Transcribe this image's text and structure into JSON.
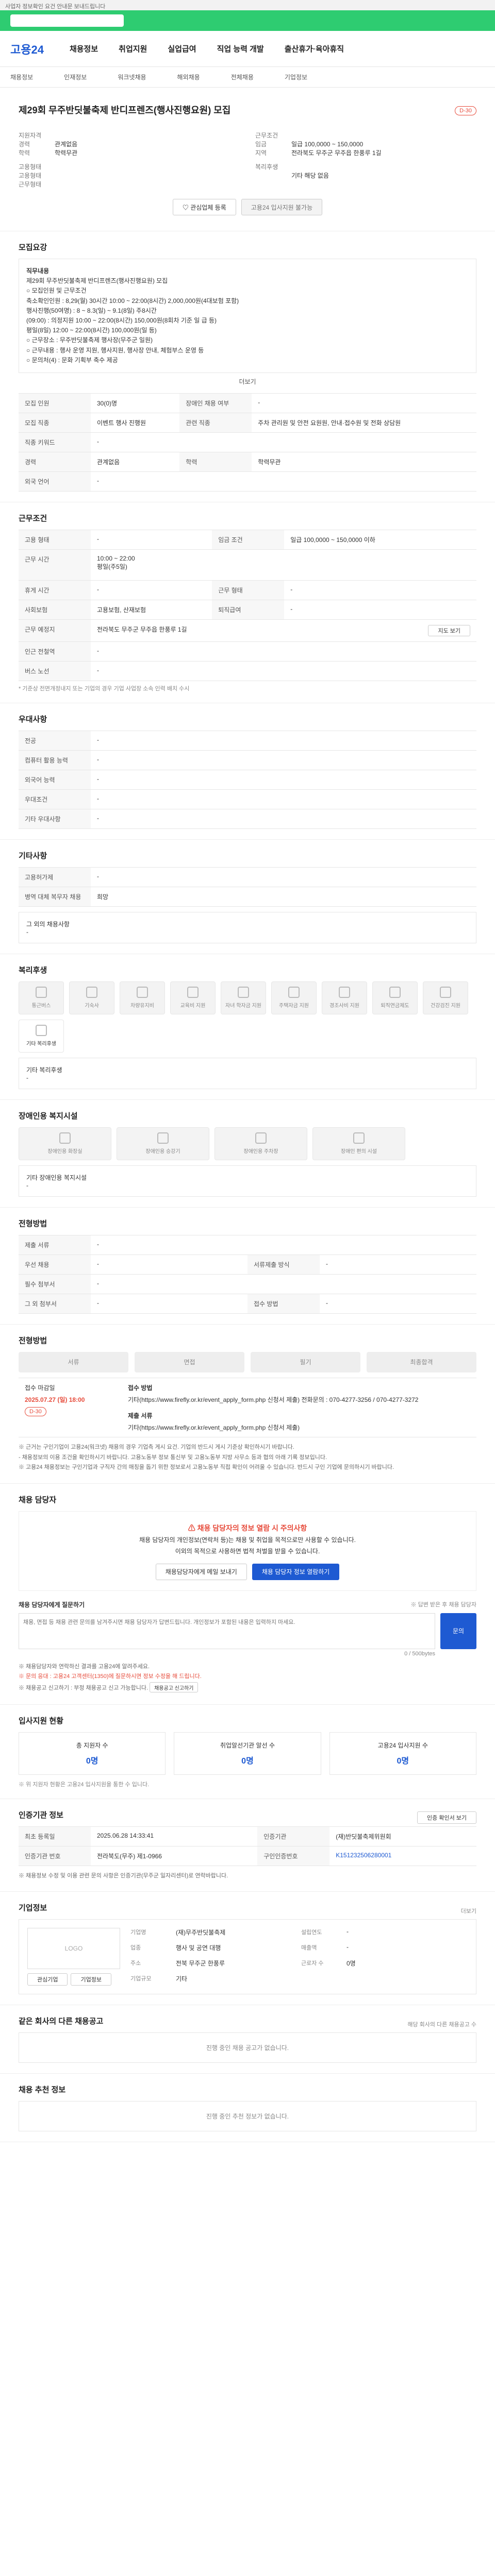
{
  "top": {
    "notice": "사업자 정보확인 요건 안내문 보내드립니다"
  },
  "nav": {
    "logo": "고용24",
    "items": [
      "채용정보",
      "취업지원",
      "실업급여",
      "직업 능력 개발",
      "출산휴가·육아휴직"
    ]
  },
  "subnav": [
    "채용정보",
    "인재정보",
    "워크넷채용",
    "해외채용",
    "전체채용",
    "기업정보"
  ],
  "job": {
    "title": "제29회 무주반딧불축제 반디프렌즈(행사진행요원) 모집",
    "dday": "D-30",
    "summary": [
      {
        "k": "지원자격",
        "v": ""
      },
      {
        "k": "경력",
        "v": "관계없음"
      },
      {
        "k": "학력",
        "v": "학력무관"
      },
      {
        "k": "고용형태",
        "v": ""
      },
      {
        "k": "고용형태",
        "v": ""
      },
      {
        "k": "근무형태",
        "v": ""
      }
    ],
    "conditions": [
      {
        "k": "근무조건",
        "v": ""
      },
      {
        "k": "임금",
        "v": "일급 100,0000 ~ 150,0000"
      },
      {
        "k": "지역",
        "v": "전라북도 무주군 무주읍 한풍루 1길"
      },
      {
        "k": "복리후생",
        "v": ""
      },
      {
        "k": "",
        "v": "기타 해당 없음"
      }
    ],
    "btn_scrap": "관심업체 등록",
    "btn_apply": "고용24 입사지원 불가능"
  },
  "recruit": {
    "heading": "모집요강",
    "content_label": "직무내용",
    "content": "제29회 무주반딧불축제 반디프렌즈(행사진행요원) 모집\n○ 모집인원 및 근무조건\n축소확인인원 : 8,29(월) 30시간 10:00 ~ 22:00(8시간) 2,000,000원(4대보험 포함)\n행사진행(50여명) : 8 ~ 8.3(일) ~ 9.1(8일) 주8시간\n(09:00) : 의정지원 10:00 ~ 22:00(8시간) 150,000원(8회차 기준 일 급 등)\n평일(8일) 12:00 ~ 22:00(8시간) 100,000원(일 등)\n○ 근무장소 : 무주반딧불축제 행사장(무주군 일원)\n○ 근무내용 : 행사 운영 지원, 행사지원, 행사장 안내, 체험부스 운영 등\n○ 문의처(4) : 문화 기획부 축수 제공",
    "more": "더보기",
    "rows": [
      {
        "k": "모집 인원",
        "v": "30(0)명",
        "k2": "장애인 채용 여부",
        "v2": "-"
      },
      {
        "k": "모집 직종",
        "v": "이벤트 행사 진행원",
        "k2": "관련 직종",
        "v2": "주차 관리원 및 안전 요원원, 안내·접수원 및 전화 상담원"
      },
      {
        "k": "직종 키워드",
        "v": "-",
        "k2": "",
        "v2": ""
      },
      {
        "k": "경력",
        "v": "관계없음",
        "k2": "학력",
        "v2": "학력무관"
      },
      {
        "k": "외국 언어",
        "v": "-",
        "k2": "",
        "v2": ""
      }
    ]
  },
  "work": {
    "heading": "근무조건",
    "rows": [
      {
        "k": "고용 형태",
        "v": "-",
        "k2": "임금 조건",
        "v2": "일급 100,0000 ~ 150,0000 이하"
      },
      {
        "k": "근무 시간",
        "v": "10:00 ~ 22:00\n평일(주5일)",
        "k2": "",
        "v2": ""
      },
      {
        "k": "휴게 시간",
        "v": "-",
        "k2": "근무 형태",
        "v2": "-"
      },
      {
        "k": "사회보험",
        "v": "고용보험, 산재보험",
        "k2": "퇴직급여",
        "v2": "-"
      },
      {
        "k": "근무 예정지",
        "v": "전라북도 무주군 무주읍 한풍루 1길",
        "k2": "",
        "v2": ""
      },
      {
        "k": "인근 전철역",
        "v": "-",
        "k2": "",
        "v2": ""
      },
      {
        "k": "버스 노선",
        "v": "-",
        "k2": "",
        "v2": ""
      }
    ],
    "map_btn": "지도 보기",
    "note": "* 기준상 전면개정내지 또는 기업의 경우 기업 사업장 소속 인력 배치 수시"
  },
  "pref": {
    "heading": "우대사항",
    "rows": [
      {
        "k": "전공",
        "v": "-"
      },
      {
        "k": "컴퓨터 활용 능력",
        "v": "-"
      },
      {
        "k": "외국어 능력",
        "v": "-"
      },
      {
        "k": "우대조건",
        "v": "-"
      },
      {
        "k": "기타 우대사항",
        "v": "-"
      }
    ]
  },
  "etc": {
    "heading": "기타사항",
    "rows": [
      {
        "k": "고용허가제",
        "v": "-"
      },
      {
        "k": "병역 대체 복무자 채용",
        "v": "희망"
      },
      {
        "k": "",
        "v": ""
      }
    ],
    "other_label": "그 외의 채용사항",
    "other_value": "-"
  },
  "welfare": {
    "heading": "복리후생",
    "items": [
      "통근버스",
      "기숙사",
      "차량유지비",
      "교육비 지원",
      "자녀 학자금 지원",
      "주택자금 지원",
      "경조사비 지원",
      "퇴직연금제도",
      "건강검진 지원",
      "기타 복리후생"
    ],
    "other_label": "기타 복리후생",
    "other_value": "-"
  },
  "disability": {
    "heading": "장애인용 복지시설",
    "items": [
      "장애인용 화장실",
      "장애인용 승강기",
      "장애인용 주차장",
      "장애인 편의 시설"
    ],
    "other_label": "기타 장애인용 복지시설",
    "other_value": "-"
  },
  "selection": {
    "heading": "전형방법",
    "rows": [
      {
        "k": "제출 서류",
        "v": "-",
        "k2": "",
        "v2": ""
      },
      {
        "k": "우선 채용",
        "v": "-",
        "k2": "서류제출 방식",
        "v2": "-"
      },
      {
        "k": "필수 첨부서",
        "v": "-",
        "k2": "",
        "v2": ""
      },
      {
        "k": "그 외 첨부서",
        "v": "-",
        "k2": "접수 방법",
        "v2": "-"
      }
    ]
  },
  "process": {
    "heading": "전형방법",
    "steps": [
      "서류",
      "면접",
      "필기",
      "최종합격"
    ],
    "deadline_label": "접수 마감일",
    "deadline": "2025.07.27 (일) 18:00",
    "deadline_dday": "D-30",
    "method_label": "접수 방법",
    "method": "기타(https://www.firefly.or.kr/event_apply_form.php 신청서 제출) 전화문의 : 070-4277-3256 / 070-4277-3272",
    "doc_label": "제출 서류",
    "doc": "기타(https://www.firefly.or.kr/event_apply_form.php 신청서 제출)",
    "notes": [
      "※ 근거는 구인기업이 고용24(워크넷) 채용의 경우 기업측 게시 요건. 기업의 반드시 게시 기준상 확인하시기 바랍니다.",
      "- 채용정보의 이용 조건을 확인하시기 바랍니다. 고용노동부 정보 통신부 및 고용노동부 지방 사무소 등과 협의 아래 기록 정보입니다.",
      "※ 고용24 채용정보는 구인기업과 구직자 간의 매칭을 돕기 위한 정보로서 고용노동부 직접 확인이 어려울 수 있습니다. 반드시 구인 기업에 문의하시기 바랍니다."
    ]
  },
  "contact": {
    "heading": "채용 담당자",
    "warn_title": "채용 담당자의 정보 열람 시 주의사항",
    "warn_body": "채용 담당자의 개인정보(연락처 등)는 채용 및 취업을 목적으로만 사용할 수 있습니다.\n이외의 목적으로 사용하면 법적 처벌을 받을 수 있습니다.",
    "btn_email": "채용담당자에게 메일 보내기",
    "btn_phone": "채용 담당자 정보 열람하기",
    "inquiry_label": "채용 담당자에게 질문하기",
    "inquiry_hint": "※ 답변 받은 후 채용 담당자",
    "inquiry_placeholder": "채용, 면접 등 채용 관련 문의를 남겨주시면 채용 담당자가 답변드립니다. 개인정보가 포함된 내용은 입력하지 마세요.",
    "counter": "0 / 500bytes",
    "btn_submit": "문의",
    "notes": [
      "※ 채용담당자와 연락하신 결과를 고용24에 알려주세요.",
      "※ 문의 응대 : 고용24 고객센터(1350)에 질문하시면 정보 수정을 해 드립니다.",
      "※ 채용공고 신고하기 : 부정 채용공고 신고 가능합니다."
    ],
    "btn_report": "채용공고 신고하기"
  },
  "applicants": {
    "heading": "입사지원 현황",
    "stats": [
      {
        "label": "총 지원자 수",
        "value": "0명"
      },
      {
        "label": "취업알선기관 알선 수",
        "value": "0명"
      },
      {
        "label": "고용24 입사지원 수",
        "value": "0명"
      }
    ],
    "note": "※ 위 지원자 현황은 고용24 입사지원을 통한 수 입니다."
  },
  "register": {
    "heading": "인증기관 정보",
    "btn_print": "인증 확인서 보기",
    "rows": [
      {
        "k": "최초 등록일",
        "v": "2025.06.28 14:33:41",
        "k2": "인증기관",
        "v2": "(재)반딧불축제위원회"
      },
      {
        "k": "인증기관 번호",
        "v": "전라북도(무주) 제1-0966",
        "k2": "구인인증번호",
        "v2": "K151232506280001"
      }
    ],
    "note": "※ 채용정보 수정 및 이용 관련 문의 사항은 인증기관(무주군 일자리센터)로 연락바랍니다."
  },
  "company": {
    "heading": "기업정보",
    "logo": "LOGO",
    "btn_favorite": "관심기업",
    "btn_info": "기업정보",
    "rows": [
      {
        "k": "기업명",
        "v": "(재)무주반딧불축제",
        "k2": "설립연도",
        "v2": "-"
      },
      {
        "k": "업종",
        "v": "행사 및 공연 대행",
        "k2": "매출액",
        "v2": "-"
      },
      {
        "k": "주소",
        "v": "전북 무주군 한풍루",
        "k2": "근로자 수",
        "v2": "0명"
      },
      {
        "k": "기업규모",
        "v": "기타",
        "k2": "",
        "v2": ""
      }
    ],
    "more": "더보기"
  },
  "similar": {
    "heading": "같은 회사의 다른 채용공고",
    "count_label": "해당 회사의 다른 채용공고 수",
    "empty": "진행 중인 채용 공고가 없습니다."
  },
  "recommend": {
    "heading": "채용 추천 정보",
    "empty": "진행 중인 추천 정보가 없습니다."
  }
}
